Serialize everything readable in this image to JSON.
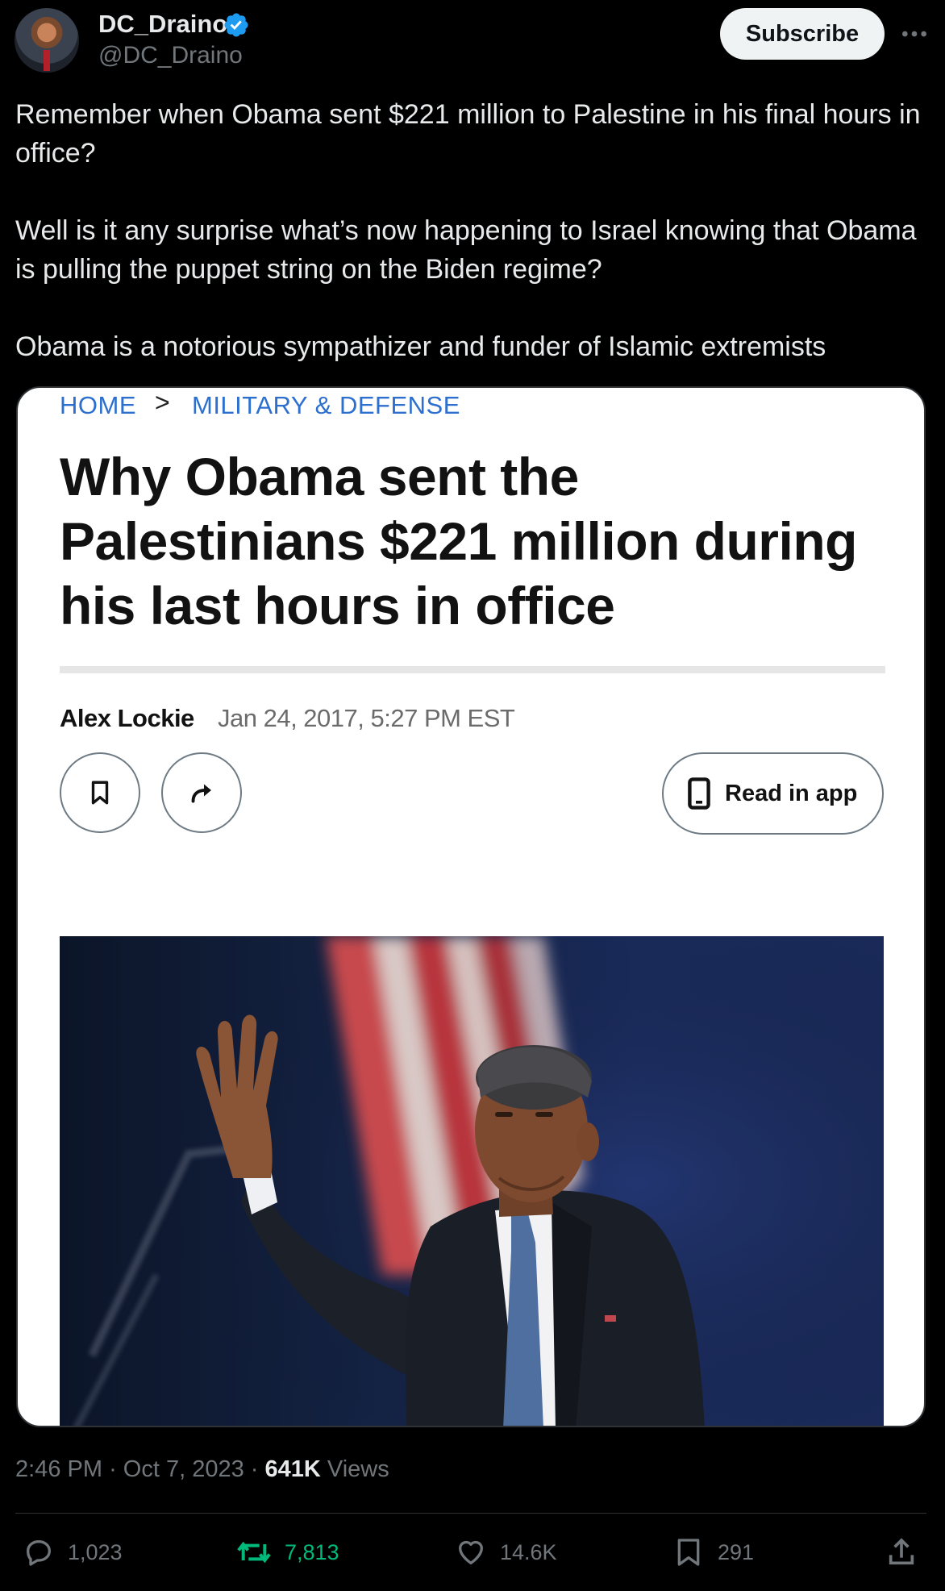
{
  "author": {
    "display_name": "DC_Draino",
    "handle": "@DC_Draino",
    "verified": true,
    "avatar_icon": "profile-photo"
  },
  "header": {
    "subscribe_label": "Subscribe",
    "more_icon": "more-horizontal-icon"
  },
  "tweet": {
    "paragraphs": [
      "Remember when Obama sent $221 million to Palestine in his final hours in office?",
      "Well is it any surprise what’s now happening to Israel knowing that Obama is pulling the puppet string on the Biden regime?",
      "Obama is a notorious sympathizer and funder of Islamic extremists"
    ]
  },
  "card": {
    "breadcrumb_home": "HOME",
    "breadcrumb_sep": ">",
    "breadcrumb_section": "MILITARY & DEFENSE",
    "headline": "Why Obama sent the Palestinians $221 million during his last hours in office",
    "author": "Alex Lockie",
    "date": "Jan 24, 2017, 5:27 PM EST",
    "read_in_app_label": "Read in app"
  },
  "meta": {
    "time": "2:46 PM",
    "date": "Oct 7, 2023",
    "views_count": "641K",
    "views_label": "Views"
  },
  "actions": {
    "replies": "1,023",
    "reposts": "7,813",
    "likes": "14.6K",
    "bookmarks": "291"
  },
  "colors": {
    "background": "#000000",
    "text": "#e7e9ea",
    "secondary": "#71767b",
    "repost_active": "#00ba7c",
    "verified": "#1d9bf0",
    "link_blue": "#2c6fcf"
  }
}
